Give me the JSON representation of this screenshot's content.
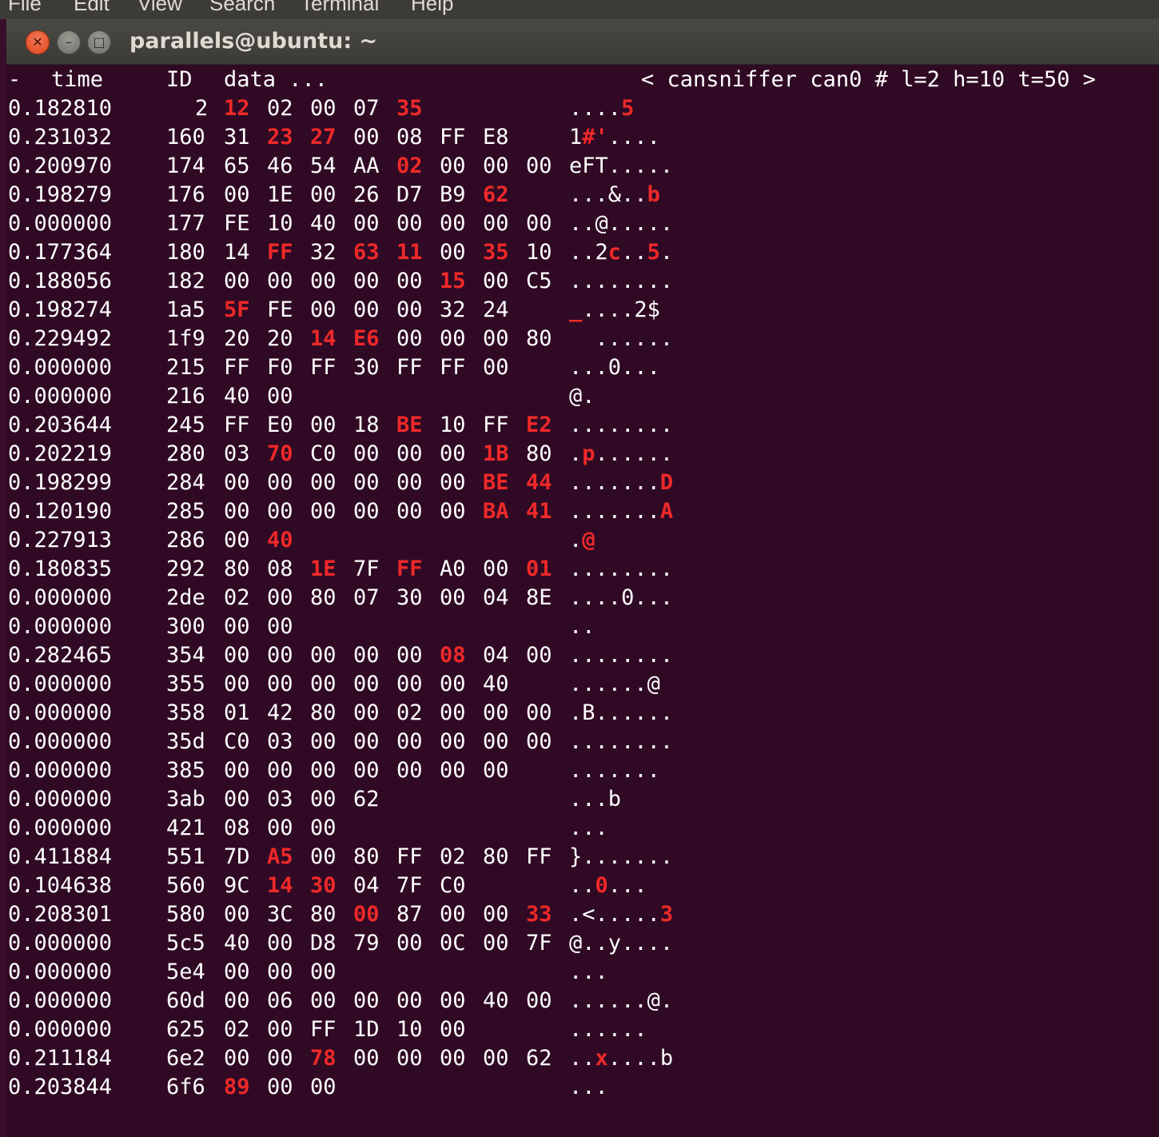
{
  "menu": [
    "File",
    "Edit",
    "View",
    "Search",
    "Terminal",
    "Help"
  ],
  "window": {
    "title": "parallels@ubuntu: ~"
  },
  "header": {
    "dash": "-",
    "time": "time",
    "id": "ID",
    "data": "data ...",
    "status": "< cansniffer can0 # l=2 h=10 t=50 >"
  },
  "colors": {
    "background": "#300a24",
    "text": "#ffffff",
    "changed": "#ef2929"
  },
  "rows": [
    {
      "time": "0.182810",
      "id": "2",
      "bytes": [
        "12",
        "02",
        "00",
        "07",
        "35"
      ],
      "hi": [
        0,
        4
      ],
      "ascii": "....5",
      "ahi": [
        4
      ]
    },
    {
      "time": "0.231032",
      "id": "160",
      "bytes": [
        "31",
        "23",
        "27",
        "00",
        "08",
        "FF",
        "E8"
      ],
      "hi": [
        1,
        2
      ],
      "ascii": "1#'....",
      "ahi": [
        1,
        2
      ]
    },
    {
      "time": "0.200970",
      "id": "174",
      "bytes": [
        "65",
        "46",
        "54",
        "AA",
        "02",
        "00",
        "00",
        "00"
      ],
      "hi": [
        4
      ],
      "ascii": "eFT.....",
      "ahi": []
    },
    {
      "time": "0.198279",
      "id": "176",
      "bytes": [
        "00",
        "1E",
        "00",
        "26",
        "D7",
        "B9",
        "62"
      ],
      "hi": [
        6
      ],
      "ascii": "...&..b",
      "ahi": [
        6
      ]
    },
    {
      "time": "0.000000",
      "id": "177",
      "bytes": [
        "FE",
        "10",
        "40",
        "00",
        "00",
        "00",
        "00",
        "00"
      ],
      "hi": [],
      "ascii": "..@.....",
      "ahi": []
    },
    {
      "time": "0.177364",
      "id": "180",
      "bytes": [
        "14",
        "FF",
        "32",
        "63",
        "11",
        "00",
        "35",
        "10"
      ],
      "hi": [
        1,
        3,
        4,
        6
      ],
      "ascii": "..2c..5.",
      "ahi": [
        3,
        6
      ]
    },
    {
      "time": "0.188056",
      "id": "182",
      "bytes": [
        "00",
        "00",
        "00",
        "00",
        "00",
        "15",
        "00",
        "C5"
      ],
      "hi": [
        5
      ],
      "ascii": "........",
      "ahi": []
    },
    {
      "time": "0.198274",
      "id": "1a5",
      "bytes": [
        "5F",
        "FE",
        "00",
        "00",
        "00",
        "32",
        "24"
      ],
      "hi": [
        0
      ],
      "ascii": "_....2$",
      "ahi": [
        0
      ]
    },
    {
      "time": "0.229492",
      "id": "1f9",
      "bytes": [
        "20",
        "20",
        "14",
        "E6",
        "00",
        "00",
        "00",
        "80"
      ],
      "hi": [
        2,
        3
      ],
      "ascii": "  ......",
      "ahi": []
    },
    {
      "time": "0.000000",
      "id": "215",
      "bytes": [
        "FF",
        "F0",
        "FF",
        "30",
        "FF",
        "FF",
        "00"
      ],
      "hi": [],
      "ascii": "...0...",
      "ahi": []
    },
    {
      "time": "0.000000",
      "id": "216",
      "bytes": [
        "40",
        "00"
      ],
      "hi": [],
      "ascii": "@.",
      "ahi": []
    },
    {
      "time": "0.203644",
      "id": "245",
      "bytes": [
        "FF",
        "E0",
        "00",
        "18",
        "BE",
        "10",
        "FF",
        "E2"
      ],
      "hi": [
        4,
        7
      ],
      "ascii": "........",
      "ahi": []
    },
    {
      "time": "0.202219",
      "id": "280",
      "bytes": [
        "03",
        "70",
        "C0",
        "00",
        "00",
        "00",
        "1B",
        "80"
      ],
      "hi": [
        1,
        6
      ],
      "ascii": ".p......",
      "ahi": [
        1
      ]
    },
    {
      "time": "0.198299",
      "id": "284",
      "bytes": [
        "00",
        "00",
        "00",
        "00",
        "00",
        "00",
        "BE",
        "44"
      ],
      "hi": [
        6,
        7
      ],
      "ascii": ".......D",
      "ahi": [
        7
      ]
    },
    {
      "time": "0.120190",
      "id": "285",
      "bytes": [
        "00",
        "00",
        "00",
        "00",
        "00",
        "00",
        "BA",
        "41"
      ],
      "hi": [
        6,
        7
      ],
      "ascii": ".......A",
      "ahi": [
        7
      ]
    },
    {
      "time": "0.227913",
      "id": "286",
      "bytes": [
        "00",
        "40"
      ],
      "hi": [
        1
      ],
      "ascii": ".@",
      "ahi": [
        1
      ]
    },
    {
      "time": "0.180835",
      "id": "292",
      "bytes": [
        "80",
        "08",
        "1E",
        "7F",
        "FF",
        "A0",
        "00",
        "01"
      ],
      "hi": [
        2,
        4,
        7
      ],
      "ascii": "........",
      "ahi": []
    },
    {
      "time": "0.000000",
      "id": "2de",
      "bytes": [
        "02",
        "00",
        "80",
        "07",
        "30",
        "00",
        "04",
        "8E"
      ],
      "hi": [],
      "ascii": "....0...",
      "ahi": []
    },
    {
      "time": "0.000000",
      "id": "300",
      "bytes": [
        "00",
        "00"
      ],
      "hi": [],
      "ascii": "..",
      "ahi": []
    },
    {
      "time": "0.282465",
      "id": "354",
      "bytes": [
        "00",
        "00",
        "00",
        "00",
        "00",
        "08",
        "04",
        "00"
      ],
      "hi": [
        5
      ],
      "ascii": "........",
      "ahi": []
    },
    {
      "time": "0.000000",
      "id": "355",
      "bytes": [
        "00",
        "00",
        "00",
        "00",
        "00",
        "00",
        "40"
      ],
      "hi": [],
      "ascii": "......@",
      "ahi": []
    },
    {
      "time": "0.000000",
      "id": "358",
      "bytes": [
        "01",
        "42",
        "80",
        "00",
        "02",
        "00",
        "00",
        "00"
      ],
      "hi": [],
      "ascii": ".B......",
      "ahi": []
    },
    {
      "time": "0.000000",
      "id": "35d",
      "bytes": [
        "C0",
        "03",
        "00",
        "00",
        "00",
        "00",
        "00",
        "00"
      ],
      "hi": [],
      "ascii": "........",
      "ahi": []
    },
    {
      "time": "0.000000",
      "id": "385",
      "bytes": [
        "00",
        "00",
        "00",
        "00",
        "00",
        "00",
        "00"
      ],
      "hi": [],
      "ascii": ".......",
      "ahi": []
    },
    {
      "time": "0.000000",
      "id": "3ab",
      "bytes": [
        "00",
        "03",
        "00",
        "62"
      ],
      "hi": [],
      "ascii": "...b",
      "ahi": []
    },
    {
      "time": "0.000000",
      "id": "421",
      "bytes": [
        "08",
        "00",
        "00"
      ],
      "hi": [],
      "ascii": "...",
      "ahi": []
    },
    {
      "time": "0.411884",
      "id": "551",
      "bytes": [
        "7D",
        "A5",
        "00",
        "80",
        "FF",
        "02",
        "80",
        "FF"
      ],
      "hi": [
        1
      ],
      "ascii": "}.......",
      "ahi": []
    },
    {
      "time": "0.104638",
      "id": "560",
      "bytes": [
        "9C",
        "14",
        "30",
        "04",
        "7F",
        "C0"
      ],
      "hi": [
        1,
        2
      ],
      "ascii": "..0...",
      "ahi": [
        2
      ]
    },
    {
      "time": "0.208301",
      "id": "580",
      "bytes": [
        "00",
        "3C",
        "80",
        "00",
        "87",
        "00",
        "00",
        "33"
      ],
      "hi": [
        3,
        7
      ],
      "ascii": ".<.....3",
      "ahi": [
        7
      ]
    },
    {
      "time": "0.000000",
      "id": "5c5",
      "bytes": [
        "40",
        "00",
        "D8",
        "79",
        "00",
        "0C",
        "00",
        "7F"
      ],
      "hi": [],
      "ascii": "@..y....",
      "ahi": []
    },
    {
      "time": "0.000000",
      "id": "5e4",
      "bytes": [
        "00",
        "00",
        "00"
      ],
      "hi": [],
      "ascii": "...",
      "ahi": []
    },
    {
      "time": "0.000000",
      "id": "60d",
      "bytes": [
        "00",
        "06",
        "00",
        "00",
        "00",
        "00",
        "40",
        "00"
      ],
      "hi": [],
      "ascii": "......@.",
      "ahi": []
    },
    {
      "time": "0.000000",
      "id": "625",
      "bytes": [
        "02",
        "00",
        "FF",
        "1D",
        "10",
        "00"
      ],
      "hi": [],
      "ascii": "......",
      "ahi": []
    },
    {
      "time": "0.211184",
      "id": "6e2",
      "bytes": [
        "00",
        "00",
        "78",
        "00",
        "00",
        "00",
        "00",
        "62"
      ],
      "hi": [
        2
      ],
      "ascii": "..x....b",
      "ahi": [
        2
      ]
    },
    {
      "time": "0.203844",
      "id": "6f6",
      "bytes": [
        "89",
        "00",
        "00"
      ],
      "hi": [
        0
      ],
      "ascii": "...",
      "ahi": []
    }
  ]
}
